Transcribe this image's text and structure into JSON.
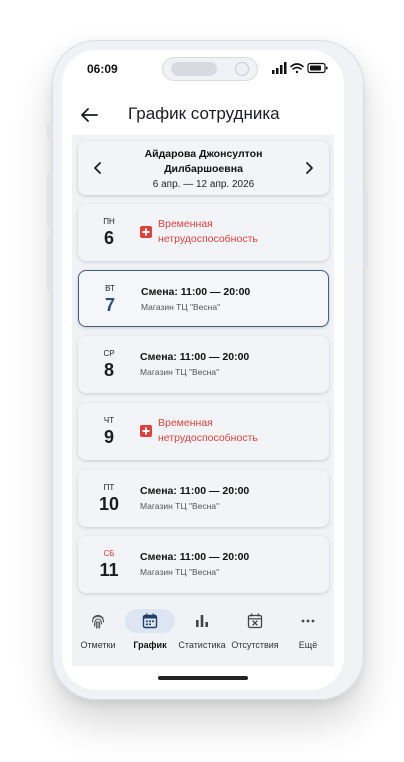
{
  "status_bar": {
    "time": "06:09"
  },
  "header": {
    "title": "График сотрудника"
  },
  "employee": {
    "name_line1": "Айдарова Джонсултон",
    "name_line2": "Дилбаршоевна",
    "date_range": "6 апр. — 12 апр. 2026"
  },
  "days": [
    {
      "dow": "ПН",
      "date": "6",
      "type": "absence",
      "absence_line1": "Временная",
      "absence_line2": "нетрудоспособность"
    },
    {
      "dow": "ВТ",
      "date": "7",
      "type": "shift",
      "selected": true,
      "shift": "Смена: 11:00 — 20:00",
      "place": "Магазин ТЦ \"Весна\""
    },
    {
      "dow": "СР",
      "date": "8",
      "type": "shift",
      "shift": "Смена: 11:00 — 20:00",
      "place": "Магазин ТЦ \"Весна\""
    },
    {
      "dow": "ЧТ",
      "date": "9",
      "type": "absence",
      "absence_line1": "Временная",
      "absence_line2": "нетрудоспособность"
    },
    {
      "dow": "ПТ",
      "date": "10",
      "type": "shift",
      "shift": "Смена: 11:00 — 20:00",
      "place": "Магазин ТЦ \"Весна\""
    },
    {
      "dow": "СБ",
      "date": "11",
      "type": "shift",
      "weekend": true,
      "shift": "Смена: 11:00 — 20:00",
      "place": "Магазин ТЦ \"Весна\""
    }
  ],
  "bottom_nav": [
    {
      "label": "Отметки",
      "icon": "fingerprint-icon"
    },
    {
      "label": "График",
      "icon": "calendar-icon",
      "active": true
    },
    {
      "label": "Статистика",
      "icon": "bar-chart-icon"
    },
    {
      "label": "Отсутствия",
      "icon": "calendar-x-icon"
    },
    {
      "label": "Ещё",
      "icon": "more-icon"
    }
  ],
  "colors": {
    "accent": "#2c4f7c",
    "absence": "#e0413a",
    "weekend": "#e0413a",
    "active_nav_bg": "#dde5f3"
  }
}
